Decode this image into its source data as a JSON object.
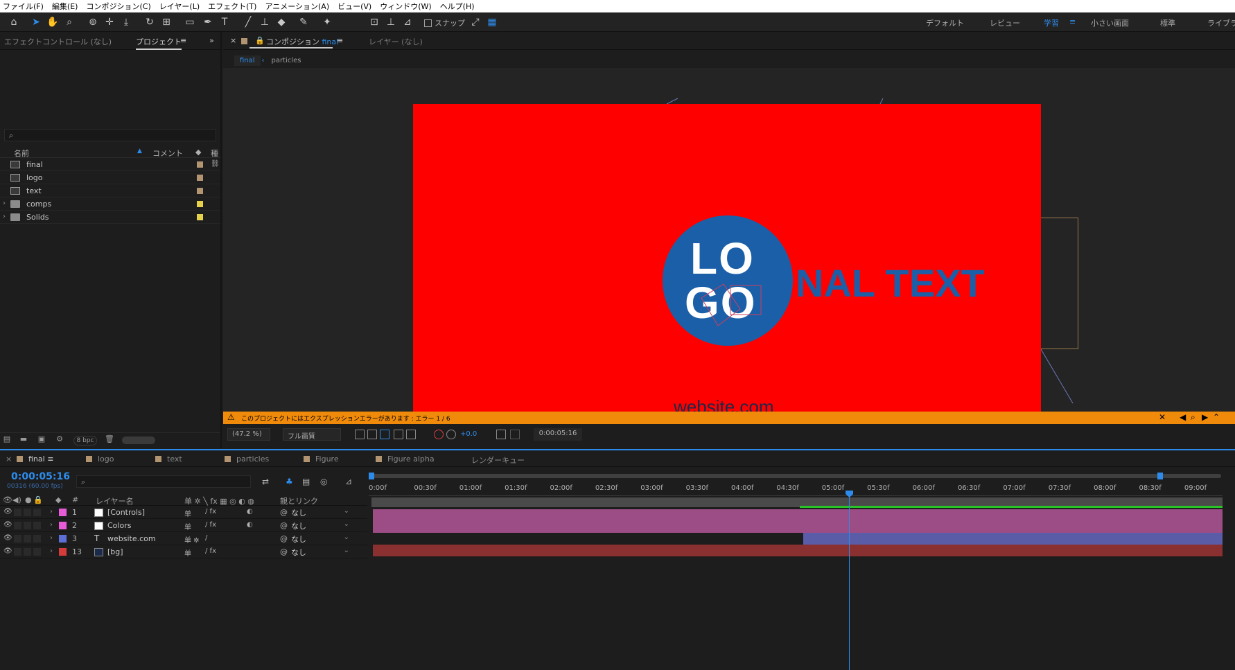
{
  "menu": [
    "ファイル(F)",
    "編集(E)",
    "コンポジション(C)",
    "レイヤー(L)",
    "エフェクト(T)",
    "アニメーション(A)",
    "ビュー(V)",
    "ウィンドウ(W)",
    "ヘルプ(H)"
  ],
  "toolbar": {
    "snap_label": "スナップ",
    "workspaces": [
      "デフォルト",
      "レビュー",
      "学習",
      "小さい画面",
      "標準",
      "ライブラリ"
    ],
    "active_workspace": "学習"
  },
  "left_panel": {
    "effect_controls_tab": "エフェクトコントロール (なし)",
    "project_tab": "プロジェクト",
    "menu_icon": "≡",
    "search_placeholder": "⌕",
    "columns": {
      "name": "名前",
      "comment": "コメント",
      "type": "種"
    },
    "items": [
      {
        "name": "final",
        "kind": "comp",
        "label_color": "#b39470",
        "expandable": false
      },
      {
        "name": "logo",
        "kind": "comp",
        "label_color": "#b39470",
        "expandable": false
      },
      {
        "name": "text",
        "kind": "comp",
        "label_color": "#b39470",
        "expandable": false
      },
      {
        "name": "comps",
        "kind": "folder",
        "label_color": "#e5d24a",
        "expandable": true
      },
      {
        "name": "Solids",
        "kind": "folder",
        "label_color": "#e5d24a",
        "expandable": true
      }
    ],
    "bpc": "8 bpc"
  },
  "viewer": {
    "comp_tab_prefix": "コンポジション",
    "comp_tab_name": "final",
    "layer_tab": "レイヤー (なし)",
    "breadcrumb": [
      "final",
      "particles"
    ],
    "canvas": {
      "background_color": "#ff0000",
      "logo_line1": "LO",
      "logo_line2": "GO",
      "headline": "NAL TEXT",
      "website": "website.com"
    },
    "error_message": "このプロジェクトにはエクスプレッションエラーがあります : エラー 1 / 6",
    "zoom": "(47.2 %)",
    "quality": "フル画質",
    "exposure": "+0.0",
    "current_time": "0:00:05:16"
  },
  "timeline": {
    "tabs": [
      {
        "label": "final",
        "active": true
      },
      {
        "label": "logo",
        "active": false
      },
      {
        "label": "text",
        "active": false
      },
      {
        "label": "particles",
        "active": false
      },
      {
        "label": "Figure",
        "active": false
      },
      {
        "label": "Figure alpha",
        "active": false
      },
      {
        "label": "レンダーキュー",
        "active": false
      }
    ],
    "timecode": "0:00:05:16",
    "frames": "00316 (60.00 fps)",
    "columns": {
      "num": "#",
      "layer_name": "レイヤー名",
      "parent": "親とリンク"
    },
    "layers": [
      {
        "num": "1",
        "name": "[Controls]",
        "color": "#e85bd6",
        "source": "solid-white",
        "switch1": "单",
        "switch2": "/ fx",
        "has_motion": true,
        "parent": "なし",
        "bar_color": "#9c4d85",
        "bar_start_sec": 0
      },
      {
        "num": "2",
        "name": "Colors",
        "color": "#e85bd6",
        "source": "solid-white",
        "switch1": "单",
        "switch2": "/ fx",
        "has_motion": true,
        "parent": "なし",
        "bar_color": "#9c4d85",
        "bar_start_sec": 0
      },
      {
        "num": "3",
        "name": "website.com",
        "color": "#5b6fd6",
        "source": "text",
        "switch1": "单 ✲",
        "switch2": "/",
        "has_motion": false,
        "parent": "なし",
        "bar_color": "#5a5ca8",
        "bar_start_sec": 4.75
      },
      {
        "num": "13",
        "name": "[bg]",
        "color": "#d63b3b",
        "source": "solid-navy",
        "switch1": "单",
        "switch2": "/ fx",
        "has_motion": false,
        "parent": "なし",
        "bar_color": "#8a3030",
        "bar_start_sec": 0
      }
    ],
    "ruler_labels": [
      "0:00f",
      "00:30f",
      "01:00f",
      "01:30f",
      "02:00f",
      "02:30f",
      "03:00f",
      "03:30f",
      "04:00f",
      "04:30f",
      "05:00f",
      "05:30f",
      "06:00f",
      "06:30f",
      "07:00f",
      "07:30f",
      "08:00f",
      "08:30f",
      "09:00f"
    ],
    "duration_sec": 9.33,
    "cti_sec": 5.27
  }
}
